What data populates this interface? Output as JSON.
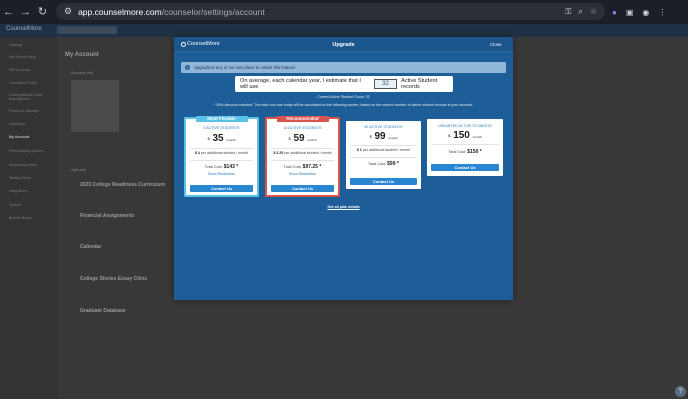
{
  "browser": {
    "url_host": "app.counselmore.com",
    "url_path": "/counselor/settings/account"
  },
  "app": {
    "logo": "CounselMore",
    "sidebar": [
      "Training",
      "My School Setup",
      "Set Up Areas",
      "Counselor Profile",
      "Undergraduate Data Management",
      "Resource Manager",
      "Reporting",
      "My Account",
      "Personalizing Options",
      "Accounting Setup",
      "Testing Setup",
      "Integrations",
      "Toolbox",
      "Bulletin Board"
    ],
    "active_item": "My Account",
    "page_title": "My Account",
    "account_info": "Account Info",
    "addons_title": "Add-ons",
    "addons": [
      "2025 College Readiness Curriculum",
      "Financial Assignments",
      "Calendar",
      "College Stories Essay Clinic",
      "Graduate Database"
    ]
  },
  "modal": {
    "logo": "CounselMore",
    "title": "Upgrade",
    "close_label": "Close",
    "banner": "Upgrade to any of our new plans to unlock this feature!",
    "estimate_prefix": "On average, each calendar year, I estimate that I will use",
    "estimate_value": "32",
    "estimate_suffix": "Active Student records",
    "current_count": "Current Active Student Count: 32",
    "discount_note": "* 25% discount included. The total cost due today will be calculated on the following screen, based on the current number of active student records in your account.",
    "see_all": "See all plan details",
    "plans": [
      {
        "ribbon": "Most Flexible",
        "name": "5 ACTIVE STUDENTS",
        "price": "35",
        "per": "/month",
        "addl_amount": "$ 4",
        "addl_text": "per additional student / month",
        "total_label": "Total Cost:",
        "total": "$143 *",
        "breakdown": "Show Breakdown",
        "cta": "Contact Us"
      },
      {
        "ribbon": "Recommended",
        "name": "10 ACTIVE STUDENTS",
        "price": "59",
        "per": "/month",
        "addl_amount": "$ 2.25",
        "addl_text": "per additional student / month",
        "total_label": "Total Cost:",
        "total": "$97.25 *",
        "breakdown": "Show Breakdown",
        "cta": "Contact Us"
      },
      {
        "ribbon": "",
        "name": "50 ACTIVE STUDENTS",
        "price": "99",
        "per": "/month",
        "addl_amount": "$ 1",
        "addl_text": "per additional student / month",
        "total_label": "Total Cost:",
        "total": "$99 *",
        "breakdown": "",
        "cta": "Contact Us"
      },
      {
        "ribbon": "",
        "name": "UNLIMITED ACTIVE STUDENTS",
        "price": "150",
        "per": "/month",
        "addl_amount": "",
        "addl_text": "",
        "total_label": "Total Cost:",
        "total": "$150 *",
        "breakdown": "",
        "cta": "Contact Us"
      }
    ]
  }
}
